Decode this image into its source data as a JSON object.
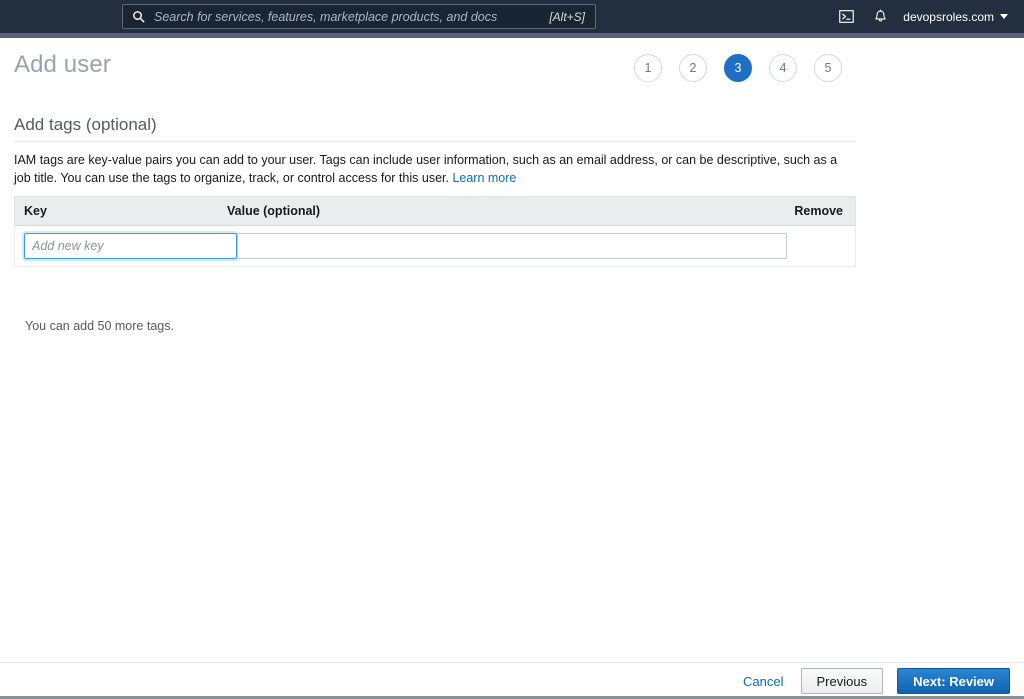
{
  "topnav": {
    "search": {
      "placeholder": "Search for services, features, marketplace products, and docs",
      "value": "",
      "shortcut": "[Alt+S]",
      "icon": "search-icon"
    },
    "cloudshell_icon": "cloudshell-icon",
    "notifications_icon": "bell-icon",
    "account": {
      "label": "devopsroles.com",
      "caret": "chevron-down-icon"
    },
    "background_color": "#232f3e"
  },
  "page": {
    "title": "Add user",
    "steps": [
      {
        "number": "1",
        "active": false
      },
      {
        "number": "2",
        "active": false
      },
      {
        "number": "3",
        "active": true
      },
      {
        "number": "4",
        "active": false
      },
      {
        "number": "5",
        "active": false
      }
    ],
    "active_step_color": "#1f6fc4",
    "section_heading": "Add tags (optional)",
    "intro_text": "IAM tags are key-value pairs you can add to your user. Tags can include user information, such as an email address, or can be descriptive, such as a job title. You can use the tags to organize, track, or control access for this user. ",
    "learn_more_label": "Learn more",
    "link_color": "#0073bb"
  },
  "tags_table": {
    "columns": {
      "key": "Key",
      "value": "Value (optional)",
      "remove": "Remove"
    },
    "rows": [
      {
        "key_value": "",
        "key_placeholder": "Add new key",
        "key_focused": true,
        "value_value": "",
        "value_placeholder": ""
      }
    ],
    "note": "You can add 50 more tags."
  },
  "footer": {
    "cancel_label": "Cancel",
    "previous_label": "Previous",
    "next_label": "Next: Review",
    "primary_color": "#1163b0"
  }
}
